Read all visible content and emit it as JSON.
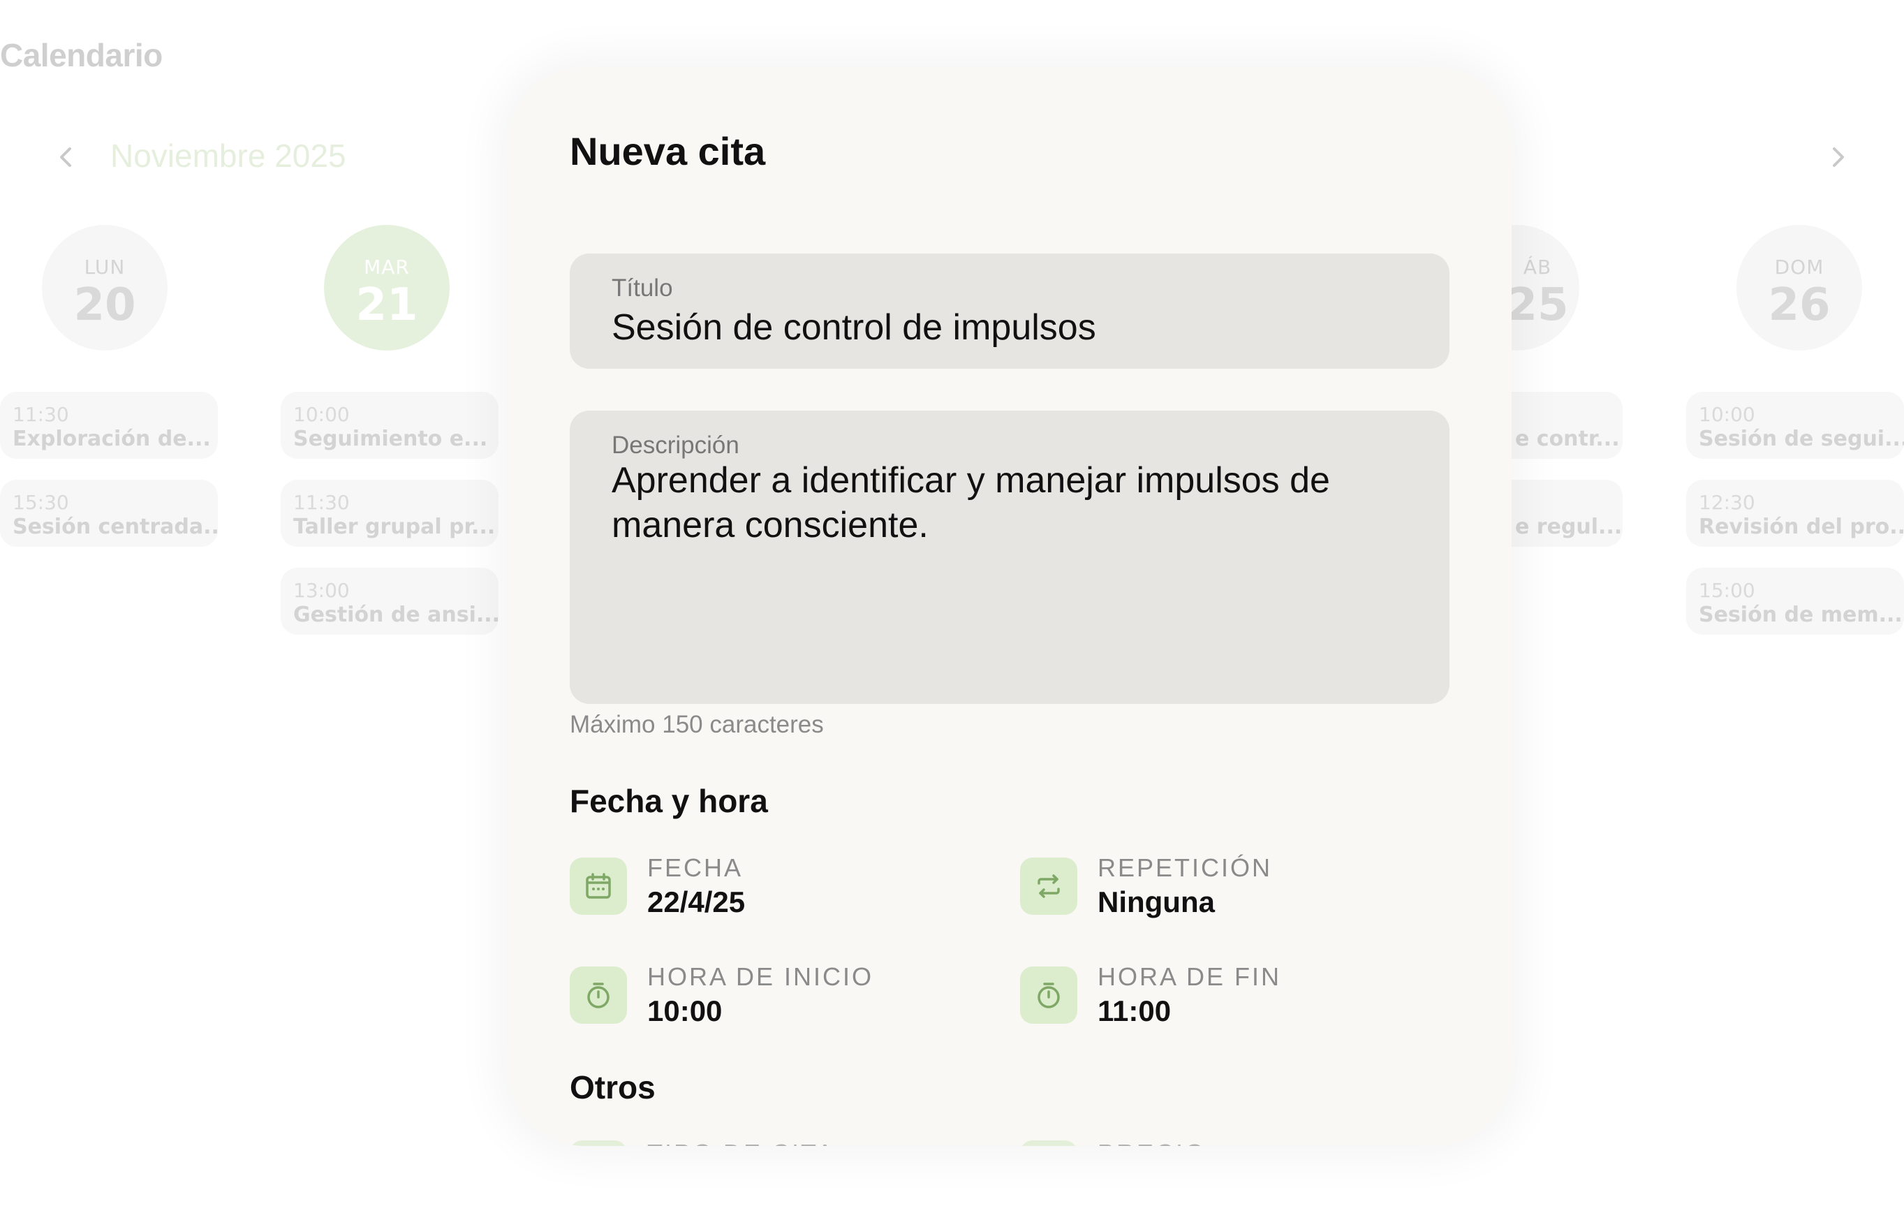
{
  "app": {
    "title": "Calendario"
  },
  "calendar": {
    "month": "Noviembre 2025",
    "days": [
      {
        "dow": "LUN",
        "num": "20",
        "selected": false,
        "appointments": [
          {
            "time": "11:30",
            "name": "Exploración de..."
          },
          {
            "time": "15:30",
            "name": "Sesión centrada..."
          }
        ]
      },
      {
        "dow": "MAR",
        "num": "21",
        "selected": true,
        "appointments": [
          {
            "time": "10:00",
            "name": "Seguimiento e..."
          },
          {
            "time": "11:30",
            "name": "Taller grupal pr..."
          },
          {
            "time": "13:00",
            "name": "Gestión de ansi..."
          }
        ]
      },
      {
        "dow": "ÁB",
        "num": "25",
        "selected": false,
        "appointments": [
          {
            "time": "",
            "name": "e contr..."
          },
          {
            "time": "",
            "name": "e regul..."
          }
        ]
      },
      {
        "dow": "DOM",
        "num": "26",
        "selected": false,
        "appointments": [
          {
            "time": "10:00",
            "name": "Sesión de segui..."
          },
          {
            "time": "12:30",
            "name": "Revisión del pro..."
          },
          {
            "time": "15:00",
            "name": "Sesión de mem..."
          }
        ]
      }
    ]
  },
  "modal": {
    "title": "Nueva cita",
    "title_field": {
      "label": "Título",
      "value": "Sesión de control de impulsos"
    },
    "description_field": {
      "label": "Descripción",
      "value": "Aprender a identificar y manejar impulsos de manera consciente."
    },
    "description_hint": "Máximo 150 caracteres",
    "datetime_section": "Fecha y hora",
    "fecha": {
      "label": "FECHA",
      "value": "22/4/25",
      "icon": "calendar-icon"
    },
    "repeticion": {
      "label": "REPETICIÓN",
      "value": "Ninguna",
      "icon": "repeat-icon"
    },
    "hora_inicio": {
      "label": "HORA DE INICIO",
      "value": "10:00",
      "icon": "timer-icon"
    },
    "hora_fin": {
      "label": "HORA DE FIN",
      "value": "11:00",
      "icon": "timer-icon"
    },
    "others_section": "Otros",
    "tipo_cita": {
      "label": "TIPO DE CITA"
    },
    "precio": {
      "label": "PRECIO"
    }
  },
  "colors": {
    "accent_light": "#dcedce",
    "accent_icon": "#7fa866",
    "modal_bg": "#f9f8f4",
    "field_bg": "#e6e5e1"
  }
}
